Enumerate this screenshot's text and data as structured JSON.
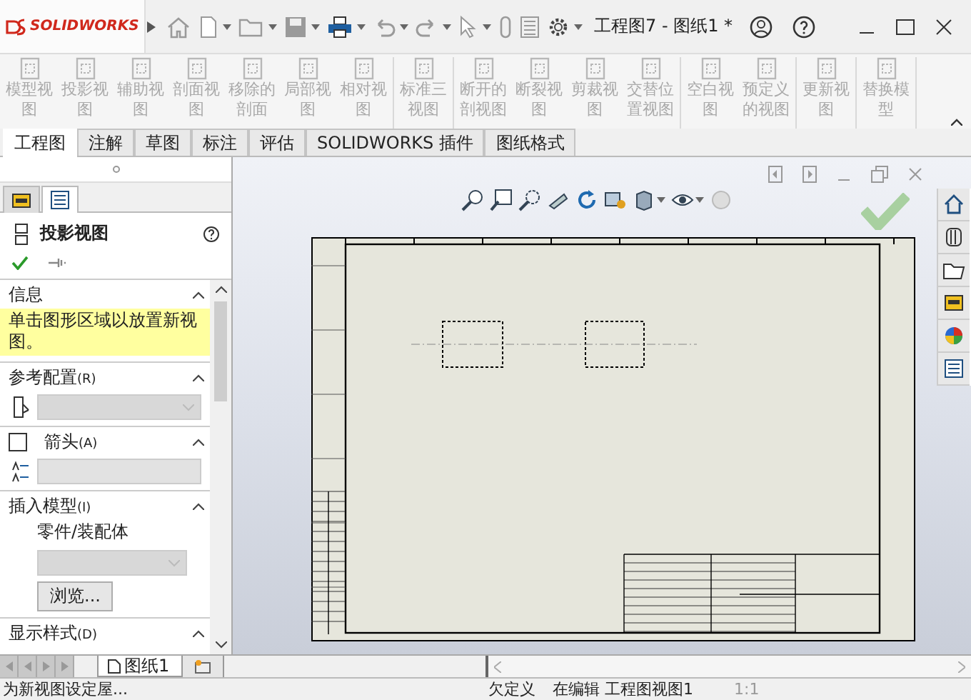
{
  "app": {
    "logo": "SOLIDWORKS",
    "title": "工程图7 - 图纸1 *"
  },
  "ribbon": {
    "groups": [
      {
        "buttons": [
          {
            "label": "模型视图",
            "disabled": true
          },
          {
            "label": "投影视图",
            "disabled": true
          },
          {
            "label": "辅助视图",
            "disabled": true
          },
          {
            "label": "剖面视图",
            "disabled": true
          },
          {
            "label": "移除的剖面",
            "disabled": true
          },
          {
            "label": "局部视图",
            "disabled": true
          },
          {
            "label": "相对视图",
            "disabled": true
          }
        ]
      },
      {
        "buttons": [
          {
            "label": "标准三视图",
            "disabled": true
          }
        ]
      },
      {
        "buttons": [
          {
            "label": "断开的剖视图",
            "disabled": true
          },
          {
            "label": "断裂视图",
            "disabled": true
          },
          {
            "label": "剪裁视图",
            "disabled": true
          },
          {
            "label": "交替位置视图",
            "disabled": true
          }
        ]
      },
      {
        "buttons": [
          {
            "label": "空白视图",
            "disabled": true
          },
          {
            "label": "预定义的视图",
            "disabled": true
          }
        ]
      },
      {
        "buttons": [
          {
            "label": "更新视图",
            "disabled": true
          }
        ]
      },
      {
        "buttons": [
          {
            "label": "替换模型",
            "disabled": true
          }
        ]
      }
    ]
  },
  "tabs": [
    {
      "label": "工程图",
      "selected": true
    },
    {
      "label": "注解",
      "selected": false
    },
    {
      "label": "草图",
      "selected": false
    },
    {
      "label": "标注",
      "selected": false
    },
    {
      "label": "评估",
      "selected": false
    },
    {
      "label": "SOLIDWORKS 插件",
      "selected": false
    },
    {
      "label": "图纸格式",
      "selected": false
    }
  ],
  "property_manager": {
    "title": "投影视图",
    "sections": [
      {
        "kind": "message",
        "title": "信息",
        "text": "单击图形区域以放置新视图。"
      },
      {
        "kind": "config",
        "title": "参考配置",
        "key": "(R)"
      },
      {
        "kind": "checkbox",
        "title": "箭头",
        "key": "(A)",
        "checked": false
      },
      {
        "kind": "model",
        "title": "插入模型",
        "key": "(I)",
        "label": "零件/装配体",
        "button": "浏览..."
      },
      {
        "kind": "header",
        "title": "显示样式",
        "key": "(D)"
      }
    ]
  },
  "sheet_tabs": [
    {
      "label": "图纸1",
      "selected": true
    }
  ],
  "status_bar": {
    "message": "为新视图设定屋...",
    "state": "欠定义",
    "editing": "在编辑 工程图视图1",
    "scale": "1:1"
  }
}
